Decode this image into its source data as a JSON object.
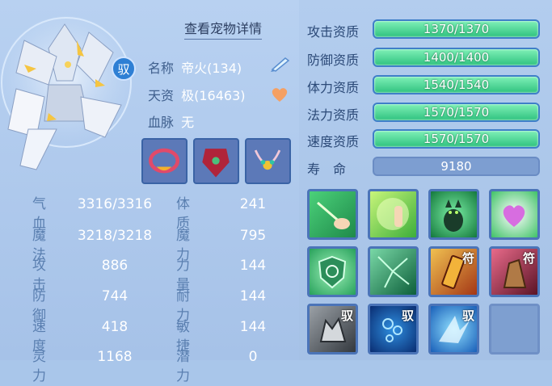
{
  "header": {
    "detail_link": "查看宠物详情"
  },
  "pet": {
    "bind_badge": "驭",
    "name_label": "名称",
    "name_value": "帝火(134)",
    "talent_label": "天资",
    "talent_value": "极(16463)",
    "blood_label": "血脉",
    "blood_value": "无"
  },
  "equipment": [
    {
      "name": "collar"
    },
    {
      "name": "armor"
    },
    {
      "name": "necklace"
    }
  ],
  "stats": [
    {
      "label": "气血",
      "value": "3316/3316"
    },
    {
      "label": "魔法",
      "value": "3218/3218"
    },
    {
      "label": "攻击",
      "value": "886"
    },
    {
      "label": "防御",
      "value": "744"
    },
    {
      "label": "速度",
      "value": "418"
    },
    {
      "label": "灵力",
      "value": "1168"
    }
  ],
  "attributes": [
    {
      "label": "体质",
      "value": "241"
    },
    {
      "label": "魔力",
      "value": "795"
    },
    {
      "label": "力量",
      "value": "144"
    },
    {
      "label": "耐力",
      "value": "144"
    },
    {
      "label": "敏捷",
      "value": "144"
    },
    {
      "label": "潜力",
      "value": "0"
    }
  ],
  "qualities": [
    {
      "label": "攻击资质",
      "value": "1370/1370"
    },
    {
      "label": "防御资质",
      "value": "1400/1400"
    },
    {
      "label": "体力资质",
      "value": "1540/1540"
    },
    {
      "label": "法力资质",
      "value": "1570/1570"
    },
    {
      "label": "速度资质",
      "value": "1570/1570"
    }
  ],
  "life": {
    "label": "寿　命",
    "value": "9180"
  },
  "skills": [
    {
      "icon": "finger-point-icon",
      "mark": ""
    },
    {
      "icon": "raised-palm-icon",
      "mark": ""
    },
    {
      "icon": "black-cat-icon",
      "mark": ""
    },
    {
      "icon": "heart-sparkle-icon",
      "mark": ""
    },
    {
      "icon": "shield-icon",
      "mark": ""
    },
    {
      "icon": "shatter-icon",
      "mark": ""
    },
    {
      "icon": "talisman-scroll-icon",
      "mark": "符"
    },
    {
      "icon": "stone-tower-icon",
      "mark": "符"
    },
    {
      "icon": "wolf-icon",
      "mark": "驭"
    },
    {
      "icon": "blue-bubbles-icon",
      "mark": "驭"
    },
    {
      "icon": "ice-shard-icon",
      "mark": "驭"
    },
    {
      "icon": "empty-slot",
      "mark": ""
    }
  ],
  "colors": {
    "accent_green": "#2fc27f",
    "label_blue": "#5a7fb0",
    "frame_blue": "#4b74b8"
  }
}
